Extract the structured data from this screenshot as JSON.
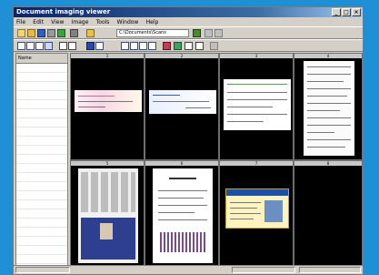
{
  "colors": {
    "desktop": "#1f8fd6",
    "titlebar": "#0a246a",
    "thumb_background": "#000000"
  },
  "window": {
    "title": "Document imaging viewer"
  },
  "menubar": {
    "items": [
      "File",
      "Edit",
      "View",
      "Image",
      "Tools",
      "Window",
      "Help"
    ]
  },
  "toolbar1": {
    "icons": [
      "new-icon",
      "open-icon",
      "save-icon",
      "print-icon",
      "help-icon",
      "scan-icon",
      "folder-icon"
    ]
  },
  "toolbar2": {
    "icons": [
      "zoom-in-icon",
      "zoom-out-icon",
      "fit-icon",
      "rotate-icon",
      "prev-page-icon",
      "next-page-icon",
      "thumbnail-icon",
      "layout-icon",
      "grid-icon",
      "select-icon",
      "crop-icon",
      "settings-icon",
      "info-icon"
    ]
  },
  "address": {
    "path": "C:\\Documents\\Scans"
  },
  "leftpane": {
    "header": "Name",
    "rows": [
      "",
      "",
      "",
      "",
      "",
      "",
      "",
      "",
      "",
      "",
      "",
      "",
      "",
      "",
      "",
      "",
      "",
      "",
      "",
      "",
      "",
      ""
    ]
  },
  "thumbnails": [
    {
      "caption": "1",
      "icon": "check-document-icon"
    },
    {
      "caption": "2",
      "icon": "check-document-icon"
    },
    {
      "caption": "3",
      "icon": "form-document-icon"
    },
    {
      "caption": "4",
      "icon": "text-document-icon"
    },
    {
      "caption": "5",
      "icon": "newspaper-document-icon"
    },
    {
      "caption": "6",
      "icon": "letter-document-icon"
    },
    {
      "caption": "7",
      "icon": "id-card-icon"
    },
    {
      "caption": "8",
      "icon": "empty-icon"
    }
  ],
  "statusbar": {
    "left": "",
    "middle": "",
    "right": ""
  }
}
